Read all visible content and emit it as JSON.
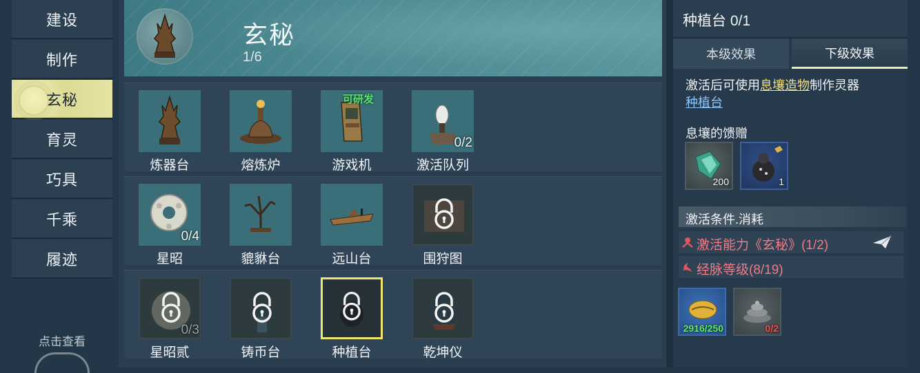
{
  "menu": {
    "items": [
      {
        "label": "建设",
        "active": false
      },
      {
        "label": "制作",
        "active": false
      },
      {
        "label": "玄秘",
        "active": true
      },
      {
        "label": "育灵",
        "active": false
      },
      {
        "label": "巧具",
        "active": false
      },
      {
        "label": "千乘",
        "active": false
      },
      {
        "label": "履迹",
        "active": false
      }
    ],
    "view_hint": "点击查看"
  },
  "banner": {
    "title": "玄秘",
    "progress": "1/6"
  },
  "grid": {
    "rows": [
      [
        {
          "name": "炼器台",
          "icon": "altar-statue-icon",
          "count": "",
          "badge": "",
          "locked": false,
          "selected": false
        },
        {
          "name": "熔炼炉",
          "icon": "furnace-icon",
          "count": "",
          "badge": "",
          "locked": false,
          "selected": false
        },
        {
          "name": "游戏机",
          "icon": "arcade-machine-icon",
          "count": "",
          "badge": "可研发",
          "locked": false,
          "selected": false
        },
        {
          "name": "激活队列",
          "icon": "crystal-pedestal-icon",
          "count": "0/2",
          "badge": "",
          "locked": false,
          "selected": false
        }
      ],
      [
        {
          "name": "星昭",
          "icon": "jade-disc-icon",
          "count": "0/4",
          "badge": "",
          "locked": false,
          "selected": false
        },
        {
          "name": "貔貅台",
          "icon": "bonsai-tree-icon",
          "count": "",
          "badge": "",
          "locked": false,
          "selected": false
        },
        {
          "name": "远山台",
          "icon": "mountain-tray-icon",
          "count": "",
          "badge": "",
          "locked": false,
          "selected": false
        },
        {
          "name": "围狩图",
          "icon": "lock-icon",
          "count": "",
          "badge": "",
          "locked": true,
          "selected": false
        }
      ],
      [
        {
          "name": "星昭贰",
          "icon": "lock-icon",
          "count": "0/3",
          "badge": "",
          "locked": true,
          "selected": false
        },
        {
          "name": "铸币台",
          "icon": "lock-icon",
          "count": "",
          "badge": "",
          "locked": true,
          "selected": false
        },
        {
          "name": "种植台",
          "icon": "lock-icon",
          "count": "",
          "badge": "",
          "locked": true,
          "selected": true
        },
        {
          "name": "乾坤仪",
          "icon": "lock-icon",
          "count": "",
          "badge": "",
          "locked": true,
          "selected": false
        }
      ]
    ]
  },
  "detail": {
    "title": "种植台 0/1",
    "tabs": [
      "本级效果",
      "下级效果"
    ],
    "active_tab": "下级效果",
    "desc_prefix": "激活后可使用",
    "desc_link": "息壤造物",
    "desc_middle": "制作灵器",
    "desc_item": "种植台",
    "gift_label": "息壤的馈赠",
    "gifts": [
      {
        "icon": "green-crystal-icon",
        "count": "200"
      },
      {
        "icon": "pot-creature-icon",
        "count": "1"
      }
    ],
    "conditions_title": "激活条件.消耗",
    "conditions": [
      {
        "icon": "skill-icon",
        "text": "激活能力《玄秘》(1/2)"
      },
      {
        "icon": "meridian-icon",
        "text": "经脉等级(8/19)"
      }
    ],
    "costs": [
      {
        "icon": "golden-shell-icon",
        "count": "2916/250",
        "color": "#5cf05a"
      },
      {
        "icon": "coiled-rope-icon",
        "count": "0/2",
        "color": "#ff4d4d"
      }
    ]
  },
  "colors": {
    "accent_yellow": "#f1e66f",
    "badge_green": "#59e06e",
    "condition_red": "#f07a86"
  }
}
